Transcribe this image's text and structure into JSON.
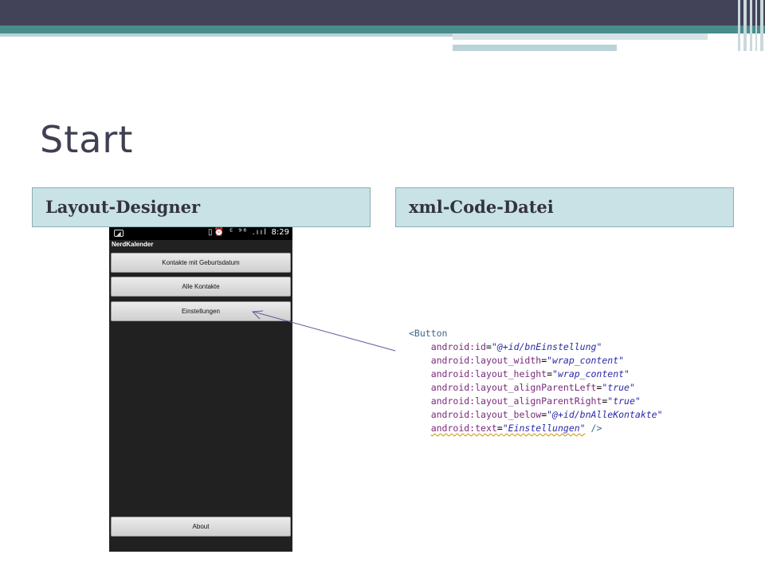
{
  "slide": {
    "title": "Start",
    "left_header": "Layout-Designer",
    "right_header": "xml-Code-Datei"
  },
  "phone": {
    "status_time": "8:29",
    "status_icons": "▯⏰ ᴱ ⁹⁶ .ııl",
    "app_title": "NerdKalender",
    "buttons": [
      "Kontakte mit Geburtsdatum",
      "Alle Kontakte",
      "Einstellungen",
      "About"
    ]
  },
  "code": {
    "open": "<Button",
    "lines": [
      {
        "attr": "android:id",
        "value": "\"@+id/bnEinstellung\""
      },
      {
        "attr": "android:layout_width",
        "value": "\"wrap_content\""
      },
      {
        "attr": "android:layout_height",
        "value": "\"wrap_content\""
      },
      {
        "attr": "android:layout_alignParentLeft",
        "value": "\"true\""
      },
      {
        "attr": "android:layout_alignParentRight",
        "value": "\"true\""
      },
      {
        "attr": "android:layout_below",
        "value": "\"@+id/bnAlleKontakte\""
      },
      {
        "attr": "android:text",
        "value": "\"Einstellungen\"",
        "close": " />"
      }
    ]
  },
  "colors": {
    "header_dark": "#424358",
    "header_teal": "#4a8c8e",
    "column_header_bg": "#c8e2e6"
  }
}
